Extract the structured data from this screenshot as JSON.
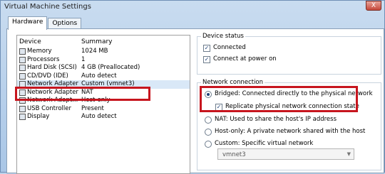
{
  "window": {
    "title": "Virtual Machine Settings",
    "close_label": "X"
  },
  "tabs": [
    {
      "label": "Hardware"
    },
    {
      "label": "Options"
    }
  ],
  "device_list": {
    "headers": {
      "device": "Device",
      "summary": "Summary"
    },
    "rows": [
      {
        "device": "Memory",
        "summary": "1024 MB",
        "icon": "memory-icon"
      },
      {
        "device": "Processors",
        "summary": "1",
        "icon": "processor-icon"
      },
      {
        "device": "Hard Disk (SCSI)",
        "summary": "4 GB (Preallocated)",
        "icon": "hard-disk-icon"
      },
      {
        "device": "CD/DVD (IDE)",
        "summary": "Auto detect",
        "icon": "cd-dvd-icon"
      },
      {
        "device": "Network Adapter",
        "summary": "Custom (vmnet3)",
        "icon": "network-adapter-icon"
      },
      {
        "device": "Network Adapter",
        "summary": "NAT",
        "icon": "network-adapter-icon"
      },
      {
        "device": "Network Adapt...",
        "summary": "Host-only",
        "icon": "network-adapter-icon"
      },
      {
        "device": "USB Controller",
        "summary": "Present",
        "icon": "usb-icon"
      },
      {
        "device": "Display",
        "summary": "Auto detect",
        "icon": "display-icon"
      }
    ]
  },
  "device_status": {
    "title": "Device status",
    "connected": {
      "label": "Connected",
      "checked": true
    },
    "connect_power_on": {
      "label": "Connect at power on",
      "checked": true
    }
  },
  "network_connection": {
    "title": "Network connection",
    "bridged": {
      "label": "Bridged: Connected directly to the physical network",
      "selected": true
    },
    "replicate": {
      "label": "Replicate physical network connection state",
      "checked": true
    },
    "nat": {
      "label": "NAT: Used to share the host's IP address",
      "selected": false
    },
    "host_only": {
      "label": "Host-only: A private network shared with the host",
      "selected": false
    },
    "custom": {
      "label": "Custom: Specific virtual network",
      "selected": false
    },
    "custom_select_value": "vmnet3"
  },
  "colors": {
    "highlight": "#c7151e",
    "accent": "#1c3e74"
  }
}
